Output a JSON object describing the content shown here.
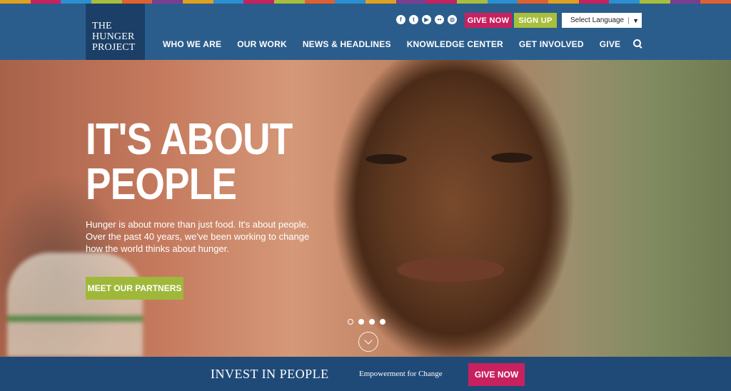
{
  "colors": {
    "header_bg": "#2b5d8c",
    "logo_bg": "#1b3f66",
    "give_pink": "#c8215f",
    "sign_up_green": "#a7bf3c",
    "footer_bg": "#1f4a78"
  },
  "top_strip_colors": [
    "#e0a020",
    "#c8215f",
    "#2b8fd0",
    "#a7bf3c",
    "#e06030",
    "#7a3d8f",
    "#e0a020",
    "#2b8fd0",
    "#c8215f",
    "#a7bf3c",
    "#e06030",
    "#2b8fd0",
    "#e0a020",
    "#7a3d8f",
    "#c8215f",
    "#a7bf3c",
    "#2b8fd0",
    "#e06030",
    "#e0a020",
    "#c8215f",
    "#2b8fd0",
    "#a7bf3c",
    "#7a3d8f",
    "#e06030"
  ],
  "logo": {
    "line1": "THE",
    "line2": "HUNGER",
    "line3": "PROJECT"
  },
  "social_icons": [
    "facebook-icon",
    "twitter-icon",
    "youtube-icon",
    "flickr-icon",
    "instagram-icon"
  ],
  "top_buttons": {
    "give": "GIVE NOW",
    "signup": "SIGN UP"
  },
  "language": {
    "label": "Select Language",
    "caret": "▼"
  },
  "nav": {
    "items": [
      "WHO WE ARE",
      "OUR WORK",
      "NEWS & HEADLINES",
      "KNOWLEDGE CENTER",
      "GET INVOLVED",
      "GIVE"
    ]
  },
  "hero": {
    "headline_line1": "IT'S ABOUT",
    "headline_line2": "PEOPLE",
    "intro": "Hunger is about more than just food. It's about people. Over the past 40 years, we've been working to change how the world thinks about hunger.",
    "cta": "MEET OUR PARTNERS",
    "slide_count": 4,
    "active_slide": 1
  },
  "footer": {
    "invest": "INVEST IN PEOPLE",
    "tagline": "Empowerment for Change",
    "give": "GIVE NOW"
  }
}
